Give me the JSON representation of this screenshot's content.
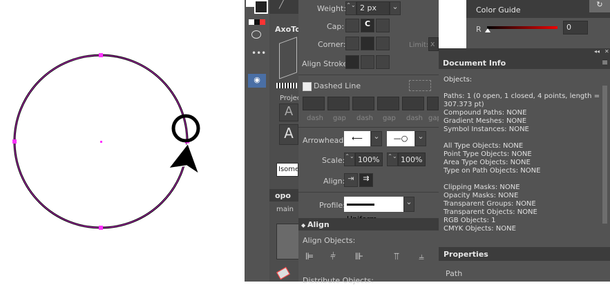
{
  "stroke": {
    "weight_label": "Weight:",
    "weight_value": "2 px",
    "cap_label": "Cap:",
    "corner_label": "Corner:",
    "limit_label": "Limit:",
    "limit_value": "x",
    "align_stroke_label": "Align Stroke:",
    "dashed_label": "Dashed Line",
    "dash_labels": [
      "dash",
      "gap",
      "dash",
      "gap",
      "dash",
      "gap"
    ],
    "arrowheads_label": "Arrowheads:",
    "scale_label": "Scale:",
    "scale_start": "100%",
    "scale_end": "100%",
    "align_label": "Align:",
    "profile_label": "Profile:",
    "profile_value": "Uniform"
  },
  "color_guide": {
    "title": "Color Guide",
    "channel": "R",
    "value": "0"
  },
  "left_panel": {
    "title": "AxoTo",
    "section": "Projec",
    "dropdown": "Isome",
    "tab2": "opo",
    "tab2_sub": "main"
  },
  "align": {
    "title": "Align",
    "align_objects": "Align Objects:",
    "distribute_objects": "Distribute Objects:"
  },
  "document_info": {
    "title": "Document Info",
    "lines": [
      "Objects:",
      "",
      "Paths: 1 (0 open, 1 closed, 4 points, length =",
      "307.373 pt)",
      "Compound Paths: NONE",
      "Gradient Meshes: NONE",
      "Symbol Instances: NONE",
      "",
      "All Type Objects: NONE",
      "Point Type Objects: NONE",
      "Area Type Objects: NONE",
      "Type on Path Objects: NONE",
      "",
      "Clipping Masks: NONE",
      "Opacity Masks: NONE",
      "Transparent Groups: NONE",
      "Transparent Objects: NONE",
      "RGB Objects: 1",
      "CMYK Objects: NONE"
    ]
  },
  "properties": {
    "title": "Properties",
    "item": "Path"
  },
  "colors": {
    "panel": "#535353",
    "field": "#3b3b3b",
    "anchor": "#ff33ff",
    "stroke": "#000000"
  }
}
